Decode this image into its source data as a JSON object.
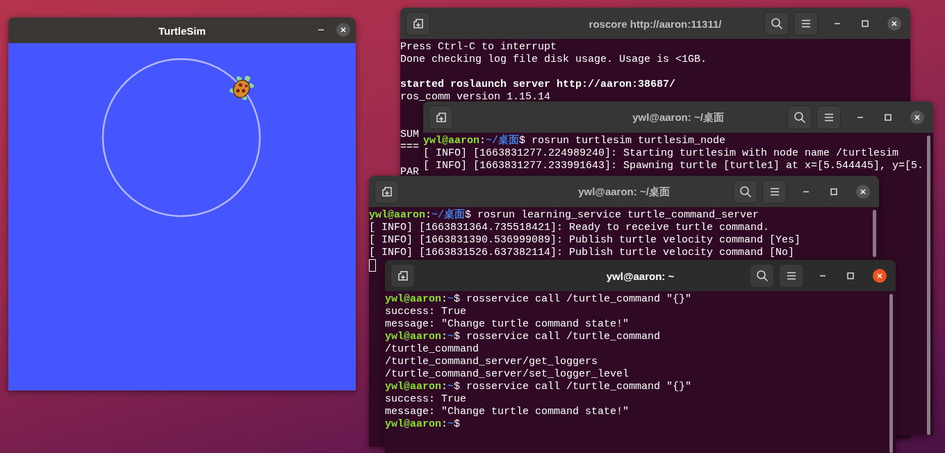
{
  "windows": [
    {
      "kind": "turtlesim",
      "title": "TurtleSim",
      "active": false
    },
    {
      "kind": "terminal",
      "title": "roscore http://aaron:11311/",
      "active": false,
      "lines": [
        {
          "kind": "output",
          "text": "Press Ctrl-C to interrupt",
          "bold": false
        },
        {
          "kind": "output",
          "text": "Done checking log file disk usage. Usage is <1GB.",
          "bold": false
        },
        {
          "kind": "blank"
        },
        {
          "kind": "output",
          "text": "started roslaunch server http://aaron:38687/",
          "bold": true
        },
        {
          "kind": "output",
          "text": "ros_comm version 1.15.14",
          "bold": false
        },
        {
          "kind": "blank"
        },
        {
          "kind": "blank"
        },
        {
          "kind": "output",
          "text": "SUM",
          "bold": false
        },
        {
          "kind": "output",
          "text": "===",
          "bold": false
        },
        {
          "kind": "blank"
        },
        {
          "kind": "output",
          "text": "PAR",
          "bold": false
        }
      ]
    },
    {
      "kind": "terminal",
      "title": "ywl@aaron: ~/桌面",
      "active": false,
      "scrollbar": true,
      "lines": [
        {
          "kind": "prompt",
          "user": "ywl@aaron",
          "sep": ":",
          "path": "~/桌面",
          "command": "$ rosrun turtlesim turtlesim_node"
        },
        {
          "kind": "output",
          "text": "[ INFO] [1663831277.224989240]: Starting turtlesim with node name /turtlesim",
          "bold": false
        },
        {
          "kind": "output",
          "text": "[ INFO] [1663831277.233991643]: Spawning turtle [turtle1] at x=[5.544445], y=[5.",
          "bold": false
        }
      ]
    },
    {
      "kind": "terminal",
      "title": "ywl@aaron: ~/桌面",
      "active": false,
      "scrollbar": true,
      "lines": [
        {
          "kind": "prompt",
          "user": "ywl@aaron",
          "sep": ":",
          "path": "~/桌面",
          "command": "$ rosrun learning_service turtle_command_server"
        },
        {
          "kind": "output",
          "text": "[ INFO] [1663831364.735518421]: Ready to receive turtle command.",
          "bold": false
        },
        {
          "kind": "output",
          "text": "[ INFO] [1663831390.536999089]: Publish turtle velocity command [Yes]",
          "bold": false
        },
        {
          "kind": "output",
          "text": "[ INFO] [1663831526.637382114]: Publish turtle velocity command [No]",
          "bold": false
        },
        {
          "kind": "cursor"
        }
      ]
    },
    {
      "kind": "terminal",
      "title": "ywl@aaron: ~",
      "active": true,
      "scrollbar": true,
      "lines": [
        {
          "kind": "prompt",
          "user": "ywl@aaron",
          "sep": ":",
          "path": "~",
          "command": "$ rosservice call /turtle_command \"{}\""
        },
        {
          "kind": "output",
          "text": "success: True",
          "bold": false
        },
        {
          "kind": "output",
          "text": "message: \"Change turtle command state!\"",
          "bold": false
        },
        {
          "kind": "prompt",
          "user": "ywl@aaron",
          "sep": ":",
          "path": "~",
          "command": "$ rosservice call /turtle_command"
        },
        {
          "kind": "output",
          "text": "/turtle_command",
          "bold": false
        },
        {
          "kind": "output",
          "text": "/turtle_command_server/get_loggers",
          "bold": false
        },
        {
          "kind": "output",
          "text": "/turtle_command_server/set_logger_level",
          "bold": false
        },
        {
          "kind": "prompt",
          "user": "ywl@aaron",
          "sep": ":",
          "path": "~",
          "command": "$ rosservice call /turtle_command \"{}\""
        },
        {
          "kind": "output",
          "text": "success: True",
          "bold": false
        },
        {
          "kind": "output",
          "text": "message: \"Change turtle command state!\"",
          "bold": false
        },
        {
          "kind": "prompt",
          "user": "ywl@aaron",
          "sep": ":",
          "path": "~",
          "command": "$"
        }
      ]
    }
  ]
}
